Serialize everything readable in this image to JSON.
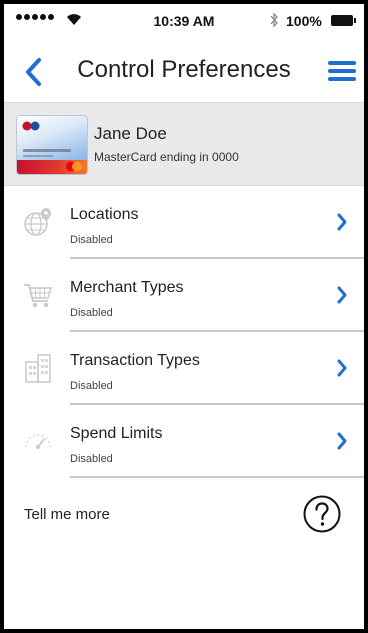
{
  "status_bar": {
    "time": "10:39 AM",
    "battery": "100%"
  },
  "nav": {
    "title": "Control Preferences",
    "back_icon": "chevron-left-icon",
    "menu_icon": "hamburger-menu-icon"
  },
  "card": {
    "name": "Jane Doe",
    "description": "MasterCard ending in 0000"
  },
  "controls": [
    {
      "title": "Locations",
      "status": "Disabled",
      "icon": "globe-pin-icon"
    },
    {
      "title": "Merchant Types",
      "status": "Disabled",
      "icon": "shopping-cart-icon"
    },
    {
      "title": "Transaction Types",
      "status": "Disabled",
      "icon": "building-icon"
    },
    {
      "title": "Spend Limits",
      "status": "Disabled",
      "icon": "speedometer-icon"
    }
  ],
  "more": {
    "label": "Tell me more",
    "help_icon": "question-circle-icon"
  },
  "colors": {
    "accent": "#1f6fd1",
    "card_row_bg": "#e9e9ec"
  }
}
